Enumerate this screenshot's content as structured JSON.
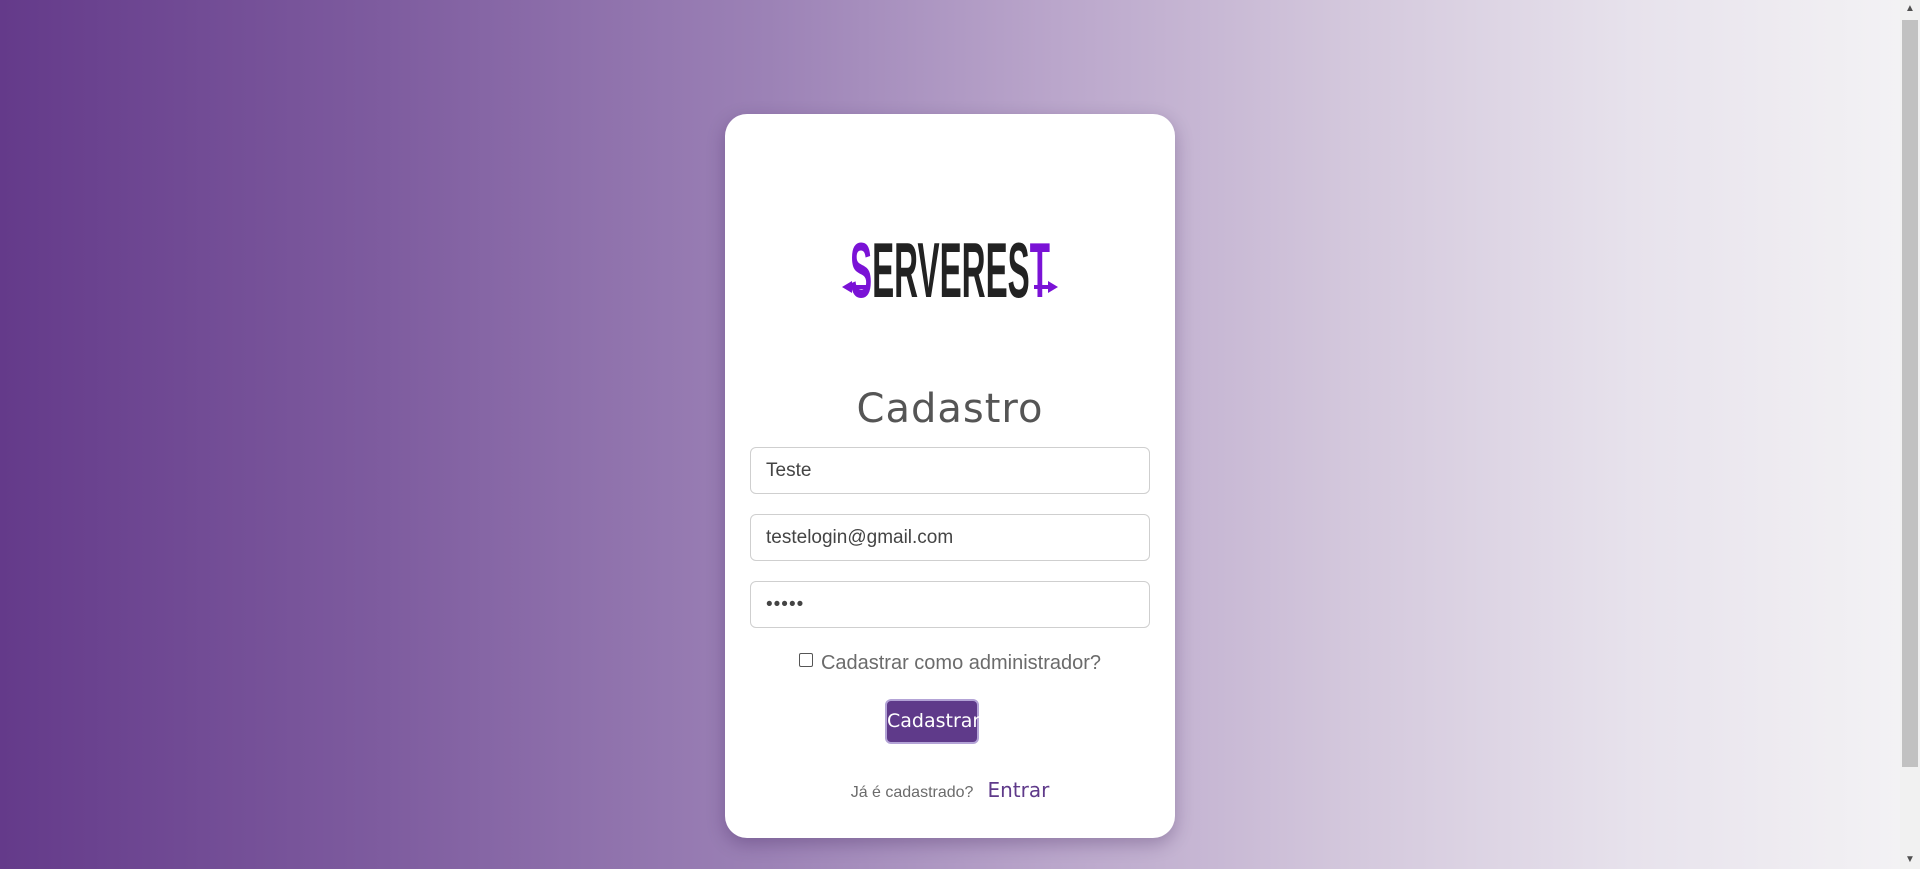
{
  "logo": {
    "text": "SERVEREST",
    "accent_color": "#7a12d6",
    "main_color": "#222222"
  },
  "form": {
    "title": "Cadastro",
    "name_value": "Teste",
    "email_value": "testelogin@gmail.com",
    "password_value": "•••••",
    "admin_checkbox_label": "Cadastrar como administrador?",
    "admin_checked": false,
    "submit_label": "Cadastrar"
  },
  "footer": {
    "question": "Já é cadastrado?",
    "login_link": "Entrar"
  },
  "colors": {
    "brand": "#5f3a8a",
    "gradient_start": "#643a8a",
    "gradient_end": "#f4f3f5"
  }
}
